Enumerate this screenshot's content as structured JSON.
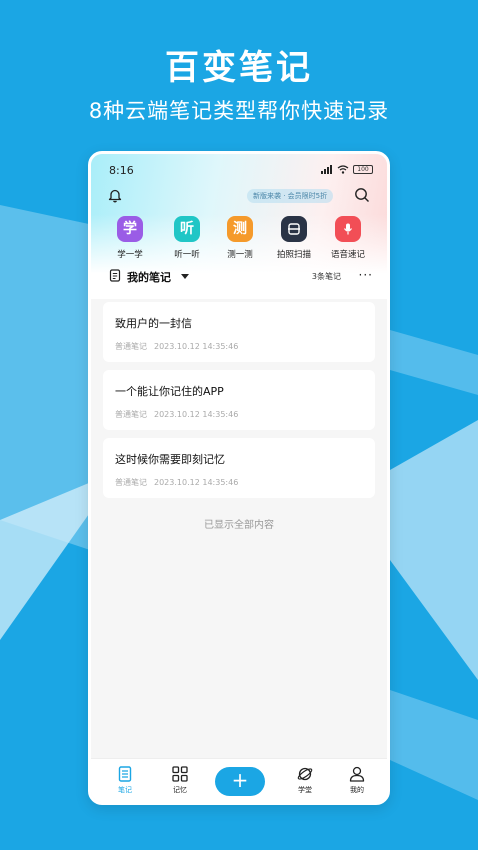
{
  "promo": {
    "title": "百变笔记",
    "subtitle": "8种云端笔记类型帮你快速记录"
  },
  "status_bar": {
    "time": "8:16",
    "battery": "100"
  },
  "header": {
    "promo_pill": "新版来袭 · 会员限时5折"
  },
  "quick_actions": [
    {
      "label": "学一学",
      "glyph": "学",
      "icon": "study-icon",
      "color": "#9a5ce6"
    },
    {
      "label": "听一听",
      "glyph": "听",
      "icon": "listen-icon",
      "color": "#20c6c6"
    },
    {
      "label": "测一测",
      "glyph": "测",
      "icon": "test-icon",
      "color": "#f59a2b"
    },
    {
      "label": "拍照扫描",
      "glyph": "",
      "icon": "scan-icon",
      "color": "#2a3345"
    },
    {
      "label": "语音速记",
      "glyph": "",
      "icon": "microphone-icon",
      "color": "#f24e56"
    }
  ],
  "notebook": {
    "title": "我的笔记",
    "count": "3条笔记"
  },
  "notes": [
    {
      "title": "致用户的一封信",
      "type": "普通笔记",
      "date": "2023.10.12 14:35:46"
    },
    {
      "title": "一个能让你记住的APP",
      "type": "普通笔记",
      "date": "2023.10.12 14:35:46"
    },
    {
      "title": "这时候你需要即刻记忆",
      "type": "普通笔记",
      "date": "2023.10.12 14:35:46"
    }
  ],
  "list_footer": "已显示全部内容",
  "tabs": [
    {
      "label": "笔记",
      "icon": "notes-icon",
      "active": true
    },
    {
      "label": "记忆",
      "icon": "grid-icon",
      "active": false
    },
    {
      "label": "学堂",
      "icon": "planet-icon",
      "active": false
    },
    {
      "label": "我的",
      "icon": "profile-icon",
      "active": false
    }
  ],
  "add_button": "+",
  "colors": {
    "brand": "#1ba6e4",
    "background": "#1ba6e4"
  }
}
